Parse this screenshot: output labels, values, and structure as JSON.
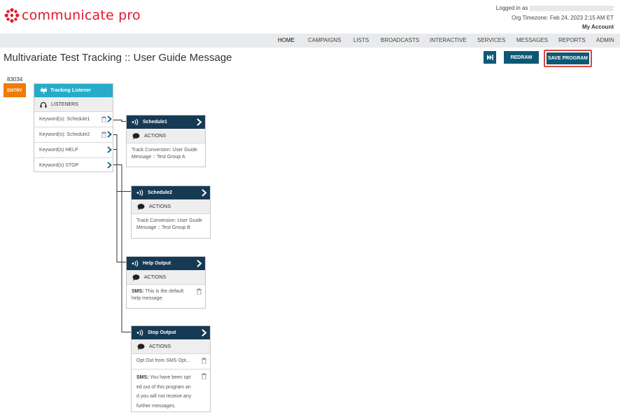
{
  "brand": {
    "name": "communicate pro",
    "color": "#e0182d"
  },
  "account": {
    "logged_in_label": "Logged in as",
    "timezone": "Org Timezone: Feb 24, 2023 2:15 AM ET",
    "my_account": "My Account"
  },
  "nav": {
    "items": [
      "HOME",
      "CAMPAIGNS",
      "LISTS",
      "BROADCASTS",
      "INTERACTIVE",
      "SERVICES",
      "MESSAGES",
      "REPORTS",
      "ADMIN"
    ],
    "active": "HOME"
  },
  "page": {
    "title": "Multivariate Test Tracking :: User Guide Message"
  },
  "toolbar": {
    "skip_icon": "skip-forward-icon",
    "redraw_label": "REDRAW",
    "save_label": "SAVE PROGRAM"
  },
  "entry": {
    "id": "83034",
    "label": "ENTRY"
  },
  "listener": {
    "title": "Tracking Listener",
    "section": "LISTENERS",
    "rows": [
      "Keyword(s): Schedule1",
      "Keyword(s): Schedule2",
      "Keyword(s) HELP",
      "Keyword(s) STOP"
    ]
  },
  "schedule1": {
    "title": "Schedule1",
    "section": "ACTIONS",
    "body": "Track Conversion: User Guide Message :: Test Group A"
  },
  "schedule2": {
    "title": "Schedule2",
    "section": "ACTIONS",
    "body": "Track Conversion: User Guide Message :: Test Group B"
  },
  "help_output": {
    "title": "Help Output",
    "section": "ACTIONS",
    "sms_label": "SMS:",
    "body": "This is the default help message."
  },
  "stop_output": {
    "title": "Stop Output",
    "section": "ACTIONS",
    "optout": "Opt Out from SMS Opt...",
    "sms_label": "SMS:",
    "body": "You have been opted out of this program and you will not receive any further messages."
  },
  "colors": {
    "node_header": "#173a54",
    "listener_header": "#26abc9",
    "entry": "#f07b05",
    "button": "#0d5975",
    "highlight": "#d9463f"
  }
}
